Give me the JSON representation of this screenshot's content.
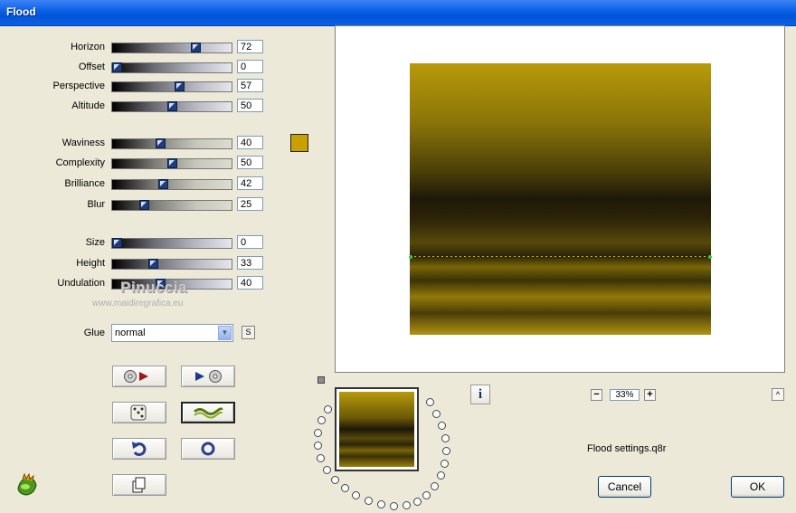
{
  "window": {
    "title": "Flood"
  },
  "sliders_group1": [
    {
      "label": "Horizon",
      "value": "72",
      "fraction": 0.72
    },
    {
      "label": "Offset",
      "value": "0",
      "fraction": 0.0
    },
    {
      "label": "Perspective",
      "value": "57",
      "fraction": 0.57
    },
    {
      "label": "Altitude",
      "value": "50",
      "fraction": 0.5
    }
  ],
  "sliders_group2": [
    {
      "label": "Waviness",
      "value": "40",
      "fraction": 0.4
    },
    {
      "label": "Complexity",
      "value": "50",
      "fraction": 0.5
    },
    {
      "label": "Brilliance",
      "value": "42",
      "fraction": 0.42
    },
    {
      "label": "Blur",
      "value": "25",
      "fraction": 0.25
    }
  ],
  "sliders_group3": [
    {
      "label": "Size",
      "value": "0",
      "fraction": 0.0
    },
    {
      "label": "Height",
      "value": "33",
      "fraction": 0.33
    },
    {
      "label": "Undulation",
      "value": "40",
      "fraction": 0.4
    }
  ],
  "color_swatch": "#c8a000",
  "glue": {
    "label": "Glue",
    "value": "normal",
    "s_button": "S"
  },
  "watermark": {
    "line1": "Pinuccia",
    "line2": "www.maidiregrafica.eu"
  },
  "icon_buttons": [
    {
      "name": "load-preset-icon"
    },
    {
      "name": "save-preset-icon"
    },
    {
      "name": "randomize-dice-icon"
    },
    {
      "name": "wave-preview-icon"
    },
    {
      "name": "undo-icon"
    },
    {
      "name": "reset-icon"
    },
    {
      "name": "copy-icon"
    }
  ],
  "info_button": "i",
  "zoom": {
    "minus": "−",
    "value": "33%",
    "plus": "+"
  },
  "up_button": "^",
  "status": {
    "settings_file": "Flood settings.q8r"
  },
  "buttons": {
    "cancel": "Cancel",
    "ok": "OK"
  },
  "colors": {
    "flood_gold": "#b89a0a",
    "titlebar": "#0a5fe8",
    "horizon_dot": "#33cc33"
  }
}
